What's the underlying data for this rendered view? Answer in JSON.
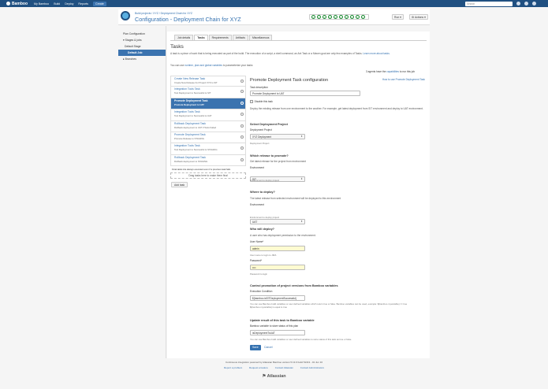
{
  "topbar": {
    "logo": "Bamboo",
    "menu": [
      "My Bamboo",
      "Build",
      "Deploy",
      "Reports"
    ],
    "create": "Create",
    "search_placeholder": "Search"
  },
  "header": {
    "breadcrumb": "Build projects  /  XYZ  /  Deployment Chain for XYZ",
    "title": "Configuration - Deployment Chain for XYZ",
    "run_label": "Run",
    "actions_label": "Actions",
    "stage_count": 10
  },
  "sidebar": {
    "items": [
      "Plan Configuration",
      "Stages & jobs",
      "Default Stage",
      "Default Job",
      "Branches"
    ]
  },
  "tabs": [
    "Job details",
    "Tasks",
    "Requirements",
    "Artifacts",
    "Miscellaneous"
  ],
  "tasks_section": {
    "title": "Tasks",
    "description": "A task is a piece of work that is being executed as part of the build. The execution of a script, a shell command, an Ant Task or a Maven goal are only few examples of Tasks.",
    "learn_more": "Learn more about tasks.",
    "vars_prefix": "You can use ",
    "vars_link": "runtime, plan and global variables",
    "vars_suffix": " to parameterize your tasks",
    "agents_prefix": "3 agents have the ",
    "agents_link": "capabilities",
    "agents_suffix": " to run this job"
  },
  "task_list": [
    {
      "name": "Create New Release Task",
      "desc": "Create New Release For Project XYZ to SIT"
    },
    {
      "name": "Integration Tools Task",
      "desc": "Test Deployment to Successful to SIT"
    },
    {
      "name": "Promote Deployment Task",
      "desc": "Promote Deployment to UAT",
      "active": true
    },
    {
      "name": "Integration Tools Task",
      "desc": "Test Deployment to Successful to UAT"
    },
    {
      "name": "Rollback Deployment Task",
      "desc": "Rollback deployment to UAT if Tests Failed"
    },
    {
      "name": "Promote Deployment Task",
      "desc": "Promote Release to STAGING"
    },
    {
      "name": "Integration Tools Task",
      "desc": "Test Deployment to Successful to STAGING"
    },
    {
      "name": "Rollback Deployment Task",
      "desc": "Rollback deployment to STAGING"
    }
  ],
  "final_tasks_note": "Final tasks  Are always executed even if a previous task fails",
  "drag_text": "Drag tasks here to make them final",
  "add_task_label": "Add task",
  "form": {
    "title": "Promote Deployment Task configuration",
    "help_link": "How to use Promote Deployment Task",
    "task_description_label": "Task description",
    "task_description_value": "Promote Deployment to UAT",
    "disable_label": "Disable this task",
    "intro": "Deploy the existing release from one environment to the another. For example, get latest deployment from SIT environment and deploy to UAT environment.",
    "select_project_heading": "Select Deployment Project",
    "project_label": "Deployment Project",
    "project_value": "XYZ Deployment",
    "project_help": "Deployment Project",
    "which_release_heading": "Which release to promote?",
    "which_release_text": "Get latest release for the project from environment",
    "env_label": "Environment",
    "env_from_value": "SIT",
    "env_from_help": "Environment to deploy project",
    "where_heading": "Where to deploy?",
    "where_text": "The latest release from selected environment will be deployed to this environment",
    "env_to_value": "UAT",
    "env_to_help": "Environment to deploy project",
    "who_heading": "Who will deploy?",
    "who_text": "A user who has deployment permission to the environment.",
    "user_label": "User Name*",
    "user_value": "admin",
    "user_help": "User name to login to JIRA",
    "password_label": "Password*",
    "password_value": "••••",
    "password_help": "Password to login",
    "control_heading": "Control promotion of project versions from Bamboo variables",
    "exec_label": "Execution Condition",
    "exec_value": "${bamboo.isSITDeploymentSuccessful}",
    "exec_help": "You can use Bamboo build variables or user defined variables which return true or false. Bamboo variables can be used, example: ${bamboo.myvariable} == true ${bamboo.myvariable} is equal to true",
    "update_heading": "Update result of this task to Bamboo variable",
    "update_label": "Bamboo variable to store status of this plan",
    "update_value": "isDeploymentToUAT",
    "update_help": "You can use Bamboo build variables or user defined variables to store status of this task as true or false.",
    "save_label": "Save",
    "cancel_label": "Cancel"
  },
  "footer": {
    "line1": "Continuous integration powered by Atlassian Bamboo version 5.13.0 build 51313 - 01 Jun 16",
    "links": [
      "Report a problem",
      "Request a feature",
      "Contact Atlassian",
      "Contact Administrators"
    ],
    "logo": "Atlassian"
  }
}
